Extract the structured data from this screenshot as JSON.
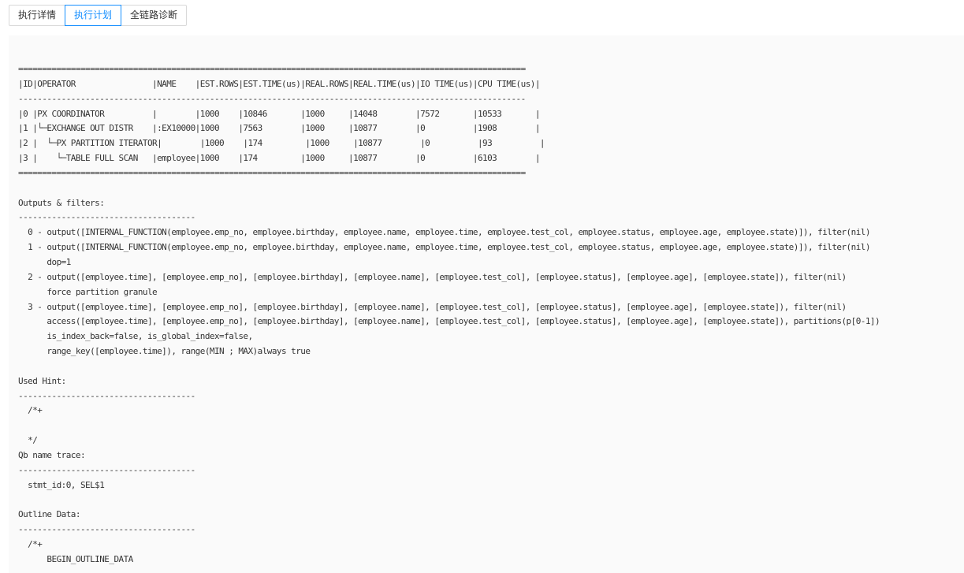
{
  "tabs": {
    "details": "执行详情",
    "plan": "执行计划",
    "diagnosis": "全链路诊断"
  },
  "colors": {
    "active_tab": "#1890ff",
    "panel_background": "#fafafa",
    "text": "#333333"
  },
  "plan": {
    "text": "==========================================================================================================\n|ID|OPERATOR                |NAME    |EST.ROWS|EST.TIME(us)|REAL.ROWS|REAL.TIME(us)|IO TIME(us)|CPU TIME(us)|\n----------------------------------------------------------------------------------------------------------\n|0 |PX COORDINATOR          |        |1000    |10846       |1000     |14048        |7572       |10533       |\n|1 |└─EXCHANGE OUT DISTR    |:EX10000|1000    |7563        |1000     |10877        |0          |1908        |\n|2 |  └─PX PARTITION ITERATOR|        |1000    |174         |1000     |10877        |0          |93          |\n|3 |    └─TABLE FULL SCAN   |employee|1000    |174         |1000     |10877        |0          |6103        |\n==========================================================================================================\n\nOutputs & filters:\n-------------------------------------\n  0 - output([INTERNAL_FUNCTION(employee.emp_no, employee.birthday, employee.name, employee.time, employee.test_col, employee.status, employee.age, employee.state)]), filter(nil)\n  1 - output([INTERNAL_FUNCTION(employee.emp_no, employee.birthday, employee.name, employee.time, employee.test_col, employee.status, employee.age, employee.state)]), filter(nil)\n      dop=1\n  2 - output([employee.time], [employee.emp_no], [employee.birthday], [employee.name], [employee.test_col], [employee.status], [employee.age], [employee.state]), filter(nil)\n      force partition granule\n  3 - output([employee.time], [employee.emp_no], [employee.birthday], [employee.name], [employee.test_col], [employee.status], [employee.age], [employee.state]), filter(nil)\n      access([employee.time], [employee.emp_no], [employee.birthday], [employee.name], [employee.test_col], [employee.status], [employee.age], [employee.state]), partitions(p[0-1])\n      is_index_back=false, is_global_index=false,\n      range_key([employee.time]), range(MIN ; MAX)always true\n\nUsed Hint:\n-------------------------------------\n  /*+\n\n  */\nQb name trace:\n-------------------------------------\n  stmt_id:0, SEL$1\n\nOutline Data:\n-------------------------------------\n  /*+\n      BEGIN_OUTLINE_DATA"
  }
}
